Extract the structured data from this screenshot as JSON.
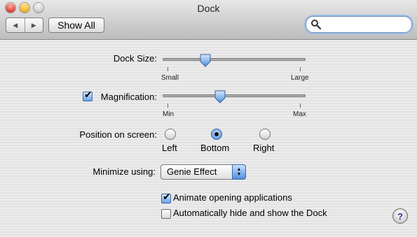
{
  "window": {
    "title": "Dock"
  },
  "toolbar": {
    "back_icon": "back-arrow-icon",
    "forward_icon": "forward-arrow-icon",
    "show_all_label": "Show All",
    "search": {
      "value": "",
      "placeholder": ""
    }
  },
  "settings": {
    "dock_size": {
      "label": "Dock Size:",
      "min_label": "Small",
      "max_label": "Large",
      "value_fraction": 0.3
    },
    "magnification": {
      "label": "Magnification:",
      "checked": true,
      "min_label": "Min",
      "max_label": "Max",
      "value_fraction": 0.4
    },
    "position": {
      "label": "Position on screen:",
      "options": [
        "Left",
        "Bottom",
        "Right"
      ],
      "selected": "Bottom"
    },
    "minimize": {
      "label": "Minimize using:",
      "value": "Genie Effect"
    },
    "animate": {
      "label": "Animate opening applications",
      "checked": true
    },
    "autohide": {
      "label": "Automatically hide and show the Dock",
      "checked": false
    }
  },
  "help": {
    "label": "?"
  },
  "colors": {
    "accent": "#5d9ae2",
    "pane_background": "#e9e9e9"
  }
}
